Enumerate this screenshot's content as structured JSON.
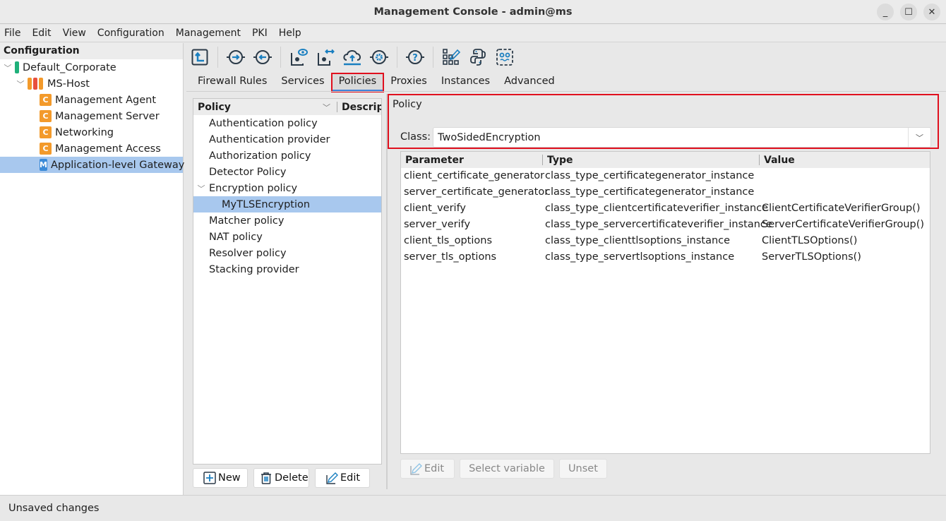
{
  "window": {
    "title": "Management Console - admin@ms",
    "controls": {
      "minimize": "_",
      "maximize": "☐",
      "close": "✕"
    }
  },
  "menubar": [
    "File",
    "Edit",
    "View",
    "Configuration",
    "Management",
    "PKI",
    "Help"
  ],
  "config_tree": {
    "header": "Configuration",
    "root": {
      "label": "Default_Corporate",
      "color": "#1fb07a"
    },
    "host": {
      "label": "MS-Host",
      "colors": [
        "#f39a2b",
        "#e8503e",
        "#f39a2b"
      ]
    },
    "components": [
      {
        "badge": "C",
        "badge_color": "#f39a2b",
        "label": "Management Agent"
      },
      {
        "badge": "C",
        "badge_color": "#f39a2b",
        "label": "Management Server"
      },
      {
        "badge": "C",
        "badge_color": "#f39a2b",
        "label": "Networking"
      },
      {
        "badge": "C",
        "badge_color": "#f39a2b",
        "label": "Management Access"
      },
      {
        "badge": "M",
        "badge_color": "#3a8ad8",
        "label": "Application-level Gateway",
        "selected": true
      }
    ]
  },
  "toolbar": {
    "icons": [
      "upload-to-parent-icon",
      "import-icon",
      "export-icon",
      "view-config-icon",
      "compare-config-icon",
      "cloud-upload-icon",
      "settings-icon",
      "help-icon",
      "edit-grid-icon",
      "python-icon",
      "robot-icon"
    ]
  },
  "tabs": [
    {
      "label": "Firewall Rules"
    },
    {
      "label": "Services"
    },
    {
      "label": "Policies",
      "active": true
    },
    {
      "label": "Proxies"
    },
    {
      "label": "Instances"
    },
    {
      "label": "Advanced"
    }
  ],
  "policy_list": {
    "columns": [
      "Policy",
      "Descript"
    ],
    "items": [
      {
        "label": "Authentication policy",
        "level": 0
      },
      {
        "label": "Authentication provider",
        "level": 0
      },
      {
        "label": "Authorization policy",
        "level": 0
      },
      {
        "label": "Detector Policy",
        "level": 0
      },
      {
        "label": "Encryption policy",
        "level": 0,
        "expanded": true
      },
      {
        "label": "MyTLSEncryption",
        "level": 1,
        "selected": true
      },
      {
        "label": "Matcher policy",
        "level": 0
      },
      {
        "label": "NAT policy",
        "level": 0
      },
      {
        "label": "Resolver policy",
        "level": 0
      },
      {
        "label": "Stacking provider",
        "level": 0
      }
    ],
    "buttons": {
      "new": "New",
      "delete": "Delete",
      "edit": "Edit"
    }
  },
  "policy_detail": {
    "group_label": "Policy",
    "class_label": "Class:",
    "class_value": "TwoSidedEncryption",
    "table": {
      "columns": [
        "Parameter",
        "Type",
        "Value"
      ],
      "rows": [
        [
          "client_certificate_generator",
          "class_type_certificategenerator_instance",
          ""
        ],
        [
          "server_certificate_generator",
          "class_type_certificategenerator_instance",
          ""
        ],
        [
          "client_verify",
          "class_type_clientcertificateverifier_instance",
          "ClientCertificateVerifierGroup()"
        ],
        [
          "server_verify",
          "class_type_servercertificateverifier_instance",
          "ServerCertificateVerifierGroup()"
        ],
        [
          "client_tls_options",
          "class_type_clienttlsoptions_instance",
          "ClientTLSOptions()"
        ],
        [
          "server_tls_options",
          "class_type_servertlsoptions_instance",
          "ServerTLSOptions()"
        ]
      ]
    },
    "buttons": {
      "edit": "Edit",
      "select_variable": "Select variable",
      "unset": "Unset"
    }
  },
  "statusbar": {
    "text": "Unsaved changes"
  }
}
